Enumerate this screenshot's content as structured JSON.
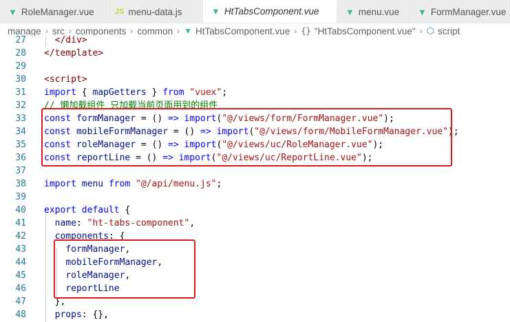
{
  "tabs": [
    {
      "label": "RoleManager.vue",
      "icon": "vue-icon",
      "active": false
    },
    {
      "label": "menu-data.js",
      "icon": "js-icon",
      "active": false
    },
    {
      "label": "HtTabsComponent.vue",
      "icon": "vue-icon",
      "active": true
    },
    {
      "label": "menu.vue",
      "icon": "vue-icon",
      "active": false
    },
    {
      "label": "FormManager.vue",
      "icon": "vue-icon",
      "active": false
    }
  ],
  "js_icon_text": "JS",
  "breadcrumb": {
    "items": [
      "manage",
      "src",
      "components",
      "common",
      "HtTabsComponent.vue",
      "\"HtTabsComponent.vue\"",
      "script"
    ],
    "brace_glyph": "{}"
  },
  "editor": {
    "lines": [
      {
        "n": "27",
        "code": "  </div>"
      },
      {
        "n": "28",
        "code": "</template>"
      },
      {
        "n": "29",
        "code": ""
      },
      {
        "n": "30",
        "code": "<script>"
      },
      {
        "n": "31",
        "code": "import { mapGetters } from \"vuex\";"
      },
      {
        "n": "32",
        "code": "// 懒加载组件 只加载当前页面用到的组件"
      },
      {
        "n": "33",
        "code": "const formManager = () => import(\"@/views/form/FormManager.vue\");"
      },
      {
        "n": "34",
        "code": "const mobileFormManager = () => import(\"@/views/form/MobileFormManager.vue\");"
      },
      {
        "n": "35",
        "code": "const roleManager = () => import(\"@/views/uc/RoleManager.vue\");"
      },
      {
        "n": "36",
        "code": "const reportLine = () => import(\"@/views/uc/ReportLine.vue\");"
      },
      {
        "n": "37",
        "code": ""
      },
      {
        "n": "38",
        "code": "import menu from \"@/api/menu.js\";"
      },
      {
        "n": "39",
        "code": ""
      },
      {
        "n": "40",
        "code": "export default {"
      },
      {
        "n": "41",
        "code": "  name: \"ht-tabs-component\","
      },
      {
        "n": "42",
        "code": "  components: {"
      },
      {
        "n": "43",
        "code": "    formManager,"
      },
      {
        "n": "44",
        "code": "    mobileFormManager,"
      },
      {
        "n": "45",
        "code": "    roleManager,"
      },
      {
        "n": "46",
        "code": "    reportLine"
      },
      {
        "n": "47",
        "code": "  },"
      },
      {
        "n": "48",
        "code": "  props: {},"
      }
    ]
  },
  "colors": {
    "keyword": "#0000ff",
    "string": "#a31515",
    "comment": "#008000",
    "variable": "#001080",
    "tag": "#800000",
    "line_number": "#237893",
    "highlight_box": "#e0191e",
    "vue_icon": "#41b883",
    "js_icon": "#cbcb41"
  }
}
